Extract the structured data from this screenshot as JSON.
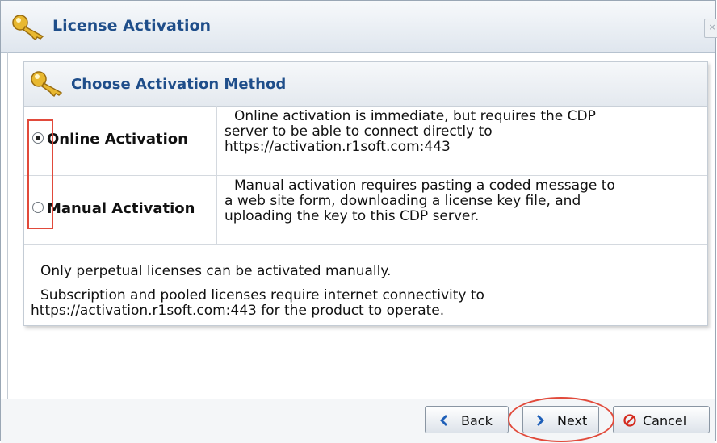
{
  "window": {
    "title": "License Activation",
    "close_label": "×"
  },
  "panel": {
    "title": "Choose Activation Method",
    "options": [
      {
        "label": "Online Activation",
        "checked": true,
        "description_lines": [
          "Online activation is immediate, but requires the CDP",
          "server to be able to connect directly to",
          "https://activation.r1soft.com:443"
        ]
      },
      {
        "label": "Manual Activation",
        "checked": false,
        "description_lines": [
          "Manual activation requires pasting a coded message to",
          "a web site form, downloading a license key file, and",
          "uploading the key to this CDP server."
        ]
      }
    ],
    "notes": [
      "Only perpetual licenses can be activated manually.",
      "Subscription and pooled licenses require internet connectivity to",
      "https://activation.r1soft.com:443 for the product to operate."
    ]
  },
  "buttons": {
    "back": "Back",
    "next": "Next",
    "cancel": "Cancel"
  },
  "icons": {
    "title": "key-icon",
    "panel": "key-icon",
    "back": "arrow-left-icon",
    "next": "arrow-right-icon",
    "cancel": "cancel-icon"
  },
  "colors": {
    "title_text": "#1f4e8a",
    "annotation": "#e14a3b",
    "arrow": "#1e5fb8"
  }
}
